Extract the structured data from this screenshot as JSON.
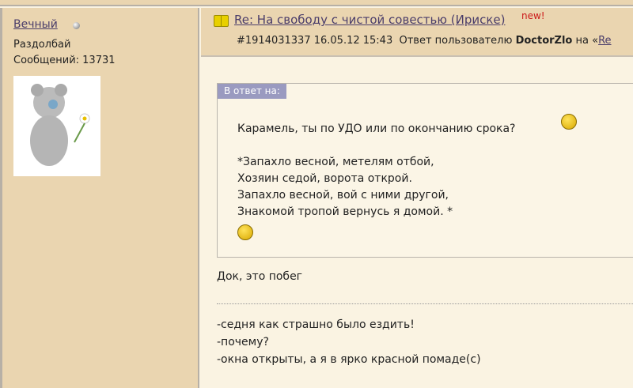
{
  "author": {
    "name": "Вечный",
    "rank": "Раздолбай",
    "posts": "Сообщений: 13731",
    "status_icon": "offline-dot-icon",
    "avatar": "teddy-bear-with-flower"
  },
  "post": {
    "title": "Re: На свободу с чистой совестью (Ириске)",
    "new_badge": "new!",
    "id_date": "#1914031337 16.05.12 15:43",
    "reply_to_prefix": "Ответ пользователю",
    "reply_to_user": "DoctorZlo",
    "reply_to_on": "на «",
    "reply_to_link": "Re",
    "accent": "#cc1a1a"
  },
  "quote": {
    "label": "В ответ на:",
    "text": "Карамель, ты по УДО или по окончанию срока?\n\n*Запахло весной, метелям отбой,\nХозяин седой, ворота открой.\nЗапахло весной, вой с ними другой,\nЗнакомой тропой вернусь я домой. *"
  },
  "body": {
    "reply": "Док, это побег",
    "lines": "-седня как страшно было ездить!\n-почему?\n-окна открыты, а я в ярко красной помаде(с)"
  }
}
